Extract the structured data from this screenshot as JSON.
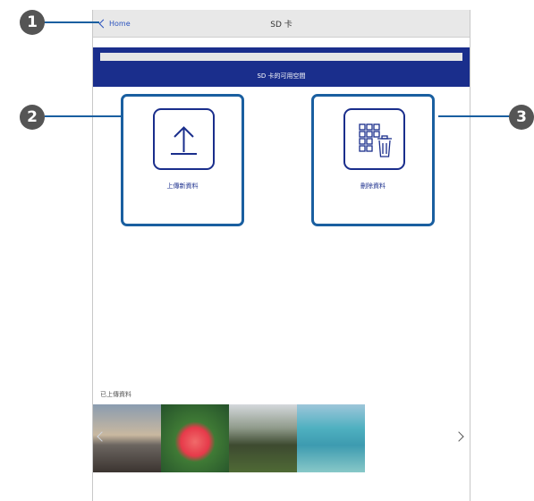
{
  "navbar": {
    "back_label": "Home",
    "title": "SD 卡"
  },
  "storage": {
    "label": "SD 卡的可用空間",
    "used_fraction": 0.0
  },
  "actions": [
    {
      "label": "上傳新資料",
      "icon": "upload-icon"
    },
    {
      "label": "刪除資料",
      "icon": "delete-icon"
    }
  ],
  "uploaded": {
    "label": "已上傳資料",
    "photos": [
      "sunset-photo",
      "hibiscus-photo",
      "trees-photo",
      "sea-photo"
    ]
  },
  "callouts": [
    "1",
    "2",
    "3"
  ],
  "colors": {
    "accent": "#1a2e8c",
    "border": "#1a5fa0",
    "callout": "#555555"
  }
}
